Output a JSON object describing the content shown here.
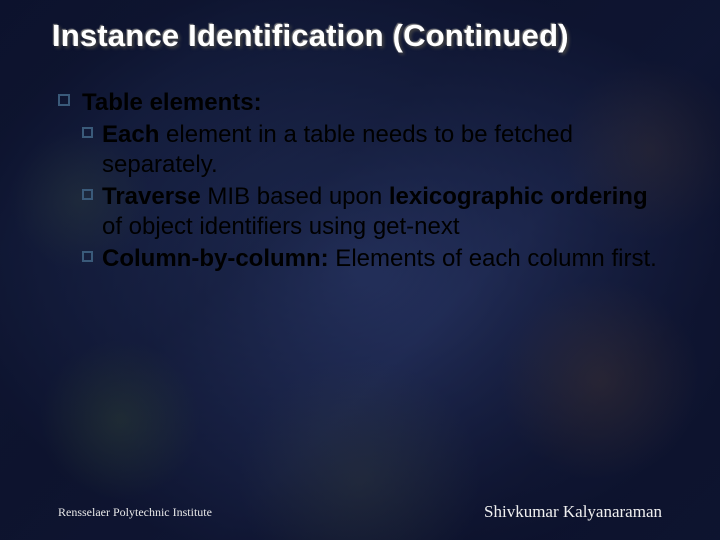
{
  "title": "Instance Identification (Continued)",
  "l1_label": "Table elements:",
  "sub1_lead": "Each",
  "sub1_rest": " element in a table needs to be fetched separately.",
  "sub2_lead": "Traverse",
  "sub2_mid": " MIB based upon ",
  "sub2_em": "lexicographic ordering",
  "sub2_rest": " of object identifiers using get-next",
  "sub3_lead": "Column-by-column:",
  "sub3_rest": " Elements of each column first.",
  "footer_left": "Rensselaer Polytechnic Institute",
  "footer_right": "Shivkumar Kalyanaraman"
}
